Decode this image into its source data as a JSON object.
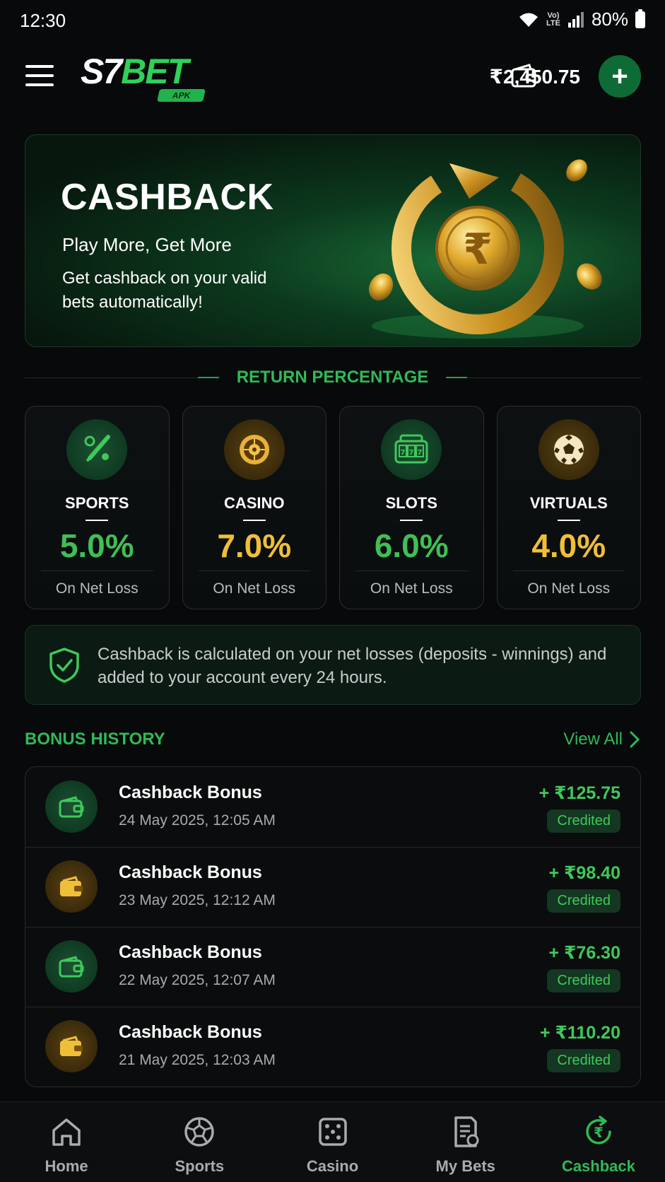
{
  "status": {
    "time": "12:30",
    "volte": "Vo)\nLTE",
    "battery": "80%"
  },
  "header": {
    "logo_main": "S7",
    "logo_bet": "BET",
    "logo_sub": "APK",
    "balance": "₹2,450.75",
    "add_label": "+"
  },
  "hero": {
    "title": "CASHBACK",
    "subtitle": "Play More, Get More",
    "description": "Get cashback on your valid bets automatically!"
  },
  "return_section": {
    "title": "RETURN PERCENTAGE"
  },
  "categories": [
    {
      "name": "SPORTS",
      "percent": "5.0%",
      "note": "On Net Loss",
      "tone": "green",
      "icon": "cricket-icon"
    },
    {
      "name": "CASINO",
      "percent": "7.0%",
      "note": "On Net Loss",
      "tone": "gold",
      "icon": "roulette-icon"
    },
    {
      "name": "SLOTS",
      "percent": "6.0%",
      "note": "On Net Loss",
      "tone": "green",
      "icon": "slot-machine-icon"
    },
    {
      "name": "VIRTUALS",
      "percent": "4.0%",
      "note": "On Net Loss",
      "tone": "gold",
      "icon": "soccer-ball-icon"
    }
  ],
  "info": {
    "text": "Cashback is calculated on your net losses (deposits - winnings) and added to your account every 24 hours."
  },
  "bonus_history": {
    "title": "BONUS HISTORY",
    "view_all": "View All",
    "items": [
      {
        "name": "Cashback Bonus",
        "date": "24 May 2025, 12:05 AM",
        "amount": "+ ₹125.75",
        "status": "Credited",
        "tone": "green"
      },
      {
        "name": "Cashback Bonus",
        "date": "23 May 2025, 12:12 AM",
        "amount": "+ ₹98.40",
        "status": "Credited",
        "tone": "gold"
      },
      {
        "name": "Cashback Bonus",
        "date": "22 May 2025, 12:07 AM",
        "amount": "+ ₹76.30",
        "status": "Credited",
        "tone": "green"
      },
      {
        "name": "Cashback Bonus",
        "date": "21 May 2025, 12:03 AM",
        "amount": "+ ₹110.20",
        "status": "Credited",
        "tone": "gold"
      }
    ]
  },
  "nav": [
    {
      "label": "Home",
      "icon": "home-icon"
    },
    {
      "label": "Sports",
      "icon": "ball-icon"
    },
    {
      "label": "Casino",
      "icon": "dice-icon"
    },
    {
      "label": "My Bets",
      "icon": "bet-slip-icon"
    },
    {
      "label": "Cashback",
      "icon": "cashback-icon",
      "active": true
    }
  ],
  "colors": {
    "accent_green": "#2fba55",
    "gold": "#f0bf38",
    "background": "#07090a"
  }
}
